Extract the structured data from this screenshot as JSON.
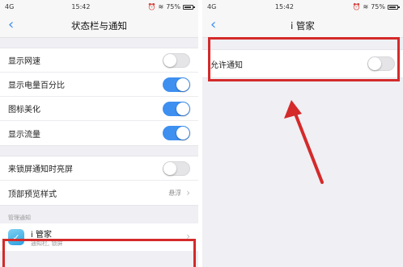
{
  "status": {
    "carrier": "4G",
    "time": "15:42",
    "battery": "75%"
  },
  "left": {
    "title": "状态栏与通知",
    "rows": [
      {
        "label": "显示网速",
        "state": "off"
      },
      {
        "label": "显示电量百分比",
        "state": "on"
      },
      {
        "label": "图标美化",
        "state": "on"
      },
      {
        "label": "显示流量",
        "state": "on"
      }
    ],
    "lockscreen_label": "来锁屏通知时亮屏",
    "preview_label": "顶部预览样式",
    "preview_value": "悬浮",
    "section_label": "管理通知",
    "app_name": "i 管家",
    "app_sub": "通知栏, 锁屏"
  },
  "right": {
    "title": "i 管家",
    "allow_label": "允许通知"
  },
  "colors": {
    "accent": "#3d8ff0",
    "highlight": "#d42a2a"
  },
  "icons": [
    "back-chevron-icon",
    "signal-icon",
    "wifi-icon",
    "battery-icon",
    "alarm-icon",
    "chevron-right-icon",
    "app-icon"
  ]
}
